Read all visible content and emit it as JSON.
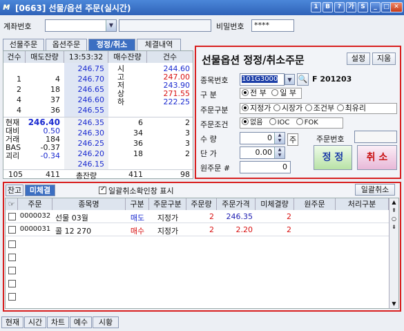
{
  "window": {
    "title": "[0663] 선물/옵션 주문(실시간)",
    "ctrl_labels": [
      "1",
      "B",
      "?",
      "가",
      "S"
    ]
  },
  "account": {
    "label": "계좌번호",
    "password_label": "비밀번호",
    "password_value": "****"
  },
  "tabs": [
    "선물주문",
    "옵션주문",
    "정정/취소",
    "체결내역"
  ],
  "orderbook": {
    "headers": [
      "건수",
      "매도잔량",
      "13:53:32",
      "매수잔량",
      "건수"
    ],
    "asks": [
      {
        "count": "",
        "qty": "",
        "price": "246.75"
      },
      {
        "count": "1",
        "qty": "4",
        "price": "246.70"
      },
      {
        "count": "2",
        "qty": "18",
        "price": "246.65"
      },
      {
        "count": "4",
        "qty": "37",
        "price": "246.60"
      },
      {
        "count": "4",
        "qty": "36",
        "price": "246.55"
      }
    ],
    "hilo": [
      "시",
      "고",
      "저",
      "상",
      "하"
    ],
    "hilo_values": [
      "244.60",
      "247.00",
      "243.90",
      "271.55",
      "222.25"
    ],
    "bids": [
      {
        "price": "246.35",
        "qty": "6",
        "count": "2"
      },
      {
        "price": "246.30",
        "qty": "34",
        "count": "3"
      },
      {
        "price": "246.25",
        "qty": "36",
        "count": "3"
      },
      {
        "price": "246.20",
        "qty": "18",
        "count": "2"
      },
      {
        "price": "246.15",
        "qty": "",
        "count": ""
      }
    ],
    "info_labels": [
      "현재",
      "대비",
      "거래",
      "BAS",
      "괴리"
    ],
    "info_values": [
      "246.40",
      "0.50",
      "184",
      "-0.37",
      "-0.34"
    ],
    "totals": {
      "ask_count": "105",
      "ask_qty": "411",
      "label": "총잔량",
      "bid_qty": "411",
      "bid_count": "98"
    }
  },
  "form": {
    "title": "선물옵션 정정/취소주문",
    "settings": "설정",
    "clear": "지움",
    "code_label": "종목번호",
    "code_value": "101G3000",
    "code_name": "F 201203",
    "side_label": "구 분",
    "side_options": [
      "전 부",
      "일 부"
    ],
    "type_label": "주문구분",
    "type_options": [
      "지정가",
      "시장가",
      "조건부",
      "최유리"
    ],
    "cond_label": "주문조건",
    "cond_options": [
      "없음",
      "IOC",
      "FOK"
    ],
    "qty_label": "수 량",
    "qty_value": "0",
    "qty_unit": "주",
    "orderno_label": "주문번호",
    "price_label": "단 가",
    "price_value": "0.00",
    "orig_label": "원주문 #",
    "orig_value": "0",
    "modify": "정 정",
    "cancel": "취 소"
  },
  "lower": {
    "tabs": [
      "잔고",
      "미체결"
    ],
    "confirm_label": "일괄취소확인창 표시",
    "cancel_all": "일괄취소",
    "headers": [
      "주문",
      "종목명",
      "구분",
      "주문구분",
      "주문량",
      "주문가격",
      "미체결량",
      "원주문",
      "처리구분"
    ],
    "rows": [
      {
        "order": "0000032",
        "name": "선물 03월",
        "side": "매도",
        "type": "지정가",
        "qty": "2",
        "price": "246.35",
        "unfilled": "2",
        "orig": "",
        "status": ""
      },
      {
        "order": "0000031",
        "name": "콜 12 270",
        "side": "매수",
        "type": "지정가",
        "qty": "2",
        "price": "2.20",
        "unfilled": "2",
        "orig": "",
        "status": ""
      }
    ]
  },
  "bottom_tabs": [
    "현재",
    "시간",
    "차트",
    "예수",
    "시황"
  ]
}
